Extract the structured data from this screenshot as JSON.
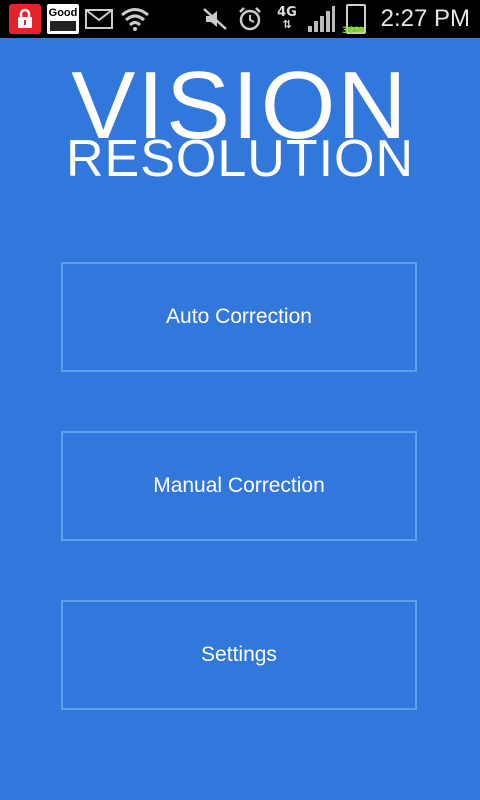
{
  "status_bar": {
    "time": "2:27 PM",
    "network": "4G",
    "battery_percent": "32%",
    "good_label": "Good",
    "icons": [
      "lock-icon",
      "good-app-icon",
      "mail-icon",
      "wifi-icon",
      "mute-icon",
      "alarm-icon",
      "4g-icon",
      "signal-icon",
      "battery-icon"
    ]
  },
  "app": {
    "title_line1": "VISION",
    "title_line2": "RESOLUTION",
    "background_color": "#3278DC"
  },
  "menu": {
    "auto_label": "Auto Correction",
    "manual_label": "Manual Correction",
    "settings_label": "Settings"
  }
}
